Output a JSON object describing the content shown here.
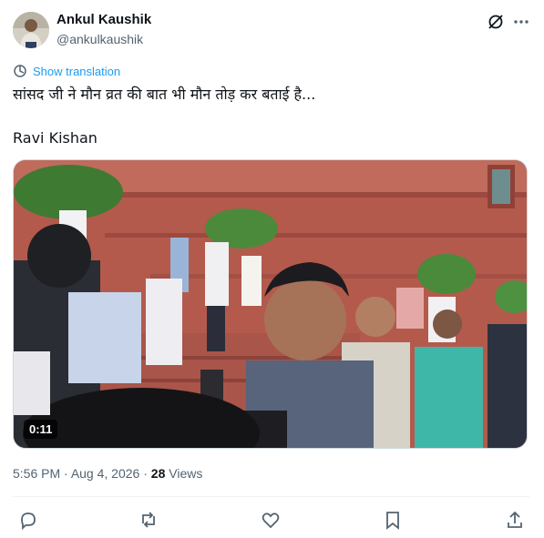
{
  "author": {
    "name": "Ankul Kaushik",
    "handle": "@ankulkaushik"
  },
  "icons": {
    "grok": "grok-icon",
    "more": "more-dots-icon",
    "translate": "translate-icon",
    "reply": "reply-icon",
    "repost": "repost-icon",
    "like": "like-icon",
    "bookmark": "bookmark-icon",
    "share": "share-icon"
  },
  "translate_label": "Show translation",
  "text_line1": "सांसद जी ने मौन व्रत की बात भी मौन तोड़ कर बताई है...",
  "text_line2": "Ravi Kishan",
  "media": {
    "duration": "0:11"
  },
  "meta": {
    "time": "5:56 PM",
    "separator1": " · ",
    "date": "Aug 4, 2026",
    "separator2": " · ",
    "views_count": "28",
    "views_label": " Views"
  },
  "colors": {
    "accent": "#1d9bf0",
    "muted": "#536471",
    "text": "#0f1419"
  }
}
